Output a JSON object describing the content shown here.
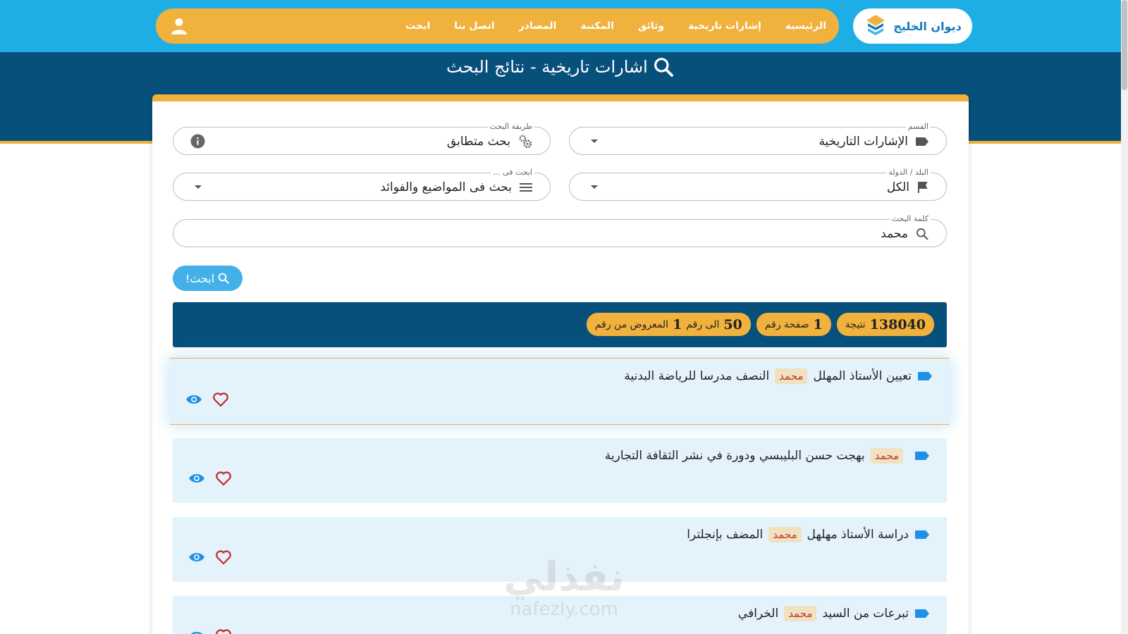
{
  "header": {
    "logo_text": "ديوان الخليج",
    "nav": [
      "الرئيسية",
      "إشارات تاريخية",
      "وثائق",
      "المكتبة",
      "المصادر",
      "اتصل بنا",
      "ابحث"
    ]
  },
  "hero": {
    "title": "اشارات تاريخية - نتائج البحث"
  },
  "filters": {
    "section": {
      "legend": "القسم",
      "value": "الإشارات التاريخية"
    },
    "method": {
      "legend": "طريقة البحث",
      "value": "بحث متطابق"
    },
    "country": {
      "legend": "البلد / الدولة",
      "value": "الكل"
    },
    "scope": {
      "legend": "ابحث فى ...",
      "value": "بحث فى المواضيع والفوائد"
    },
    "keyword": {
      "legend": "كلمة البحث",
      "value": "محمد"
    }
  },
  "search_button": "ابحث!",
  "stats": {
    "count_label": "نتيجة",
    "count": "138040",
    "page_label": "صفحة رقم",
    "page": "1",
    "shown_label": "المعروض من رقم",
    "from": "1",
    "to_label": "الى رقم",
    "to": "50"
  },
  "results": [
    {
      "before": "تعيين الأستاذ المهلل",
      "keyword": "محمد",
      "after": "النصف مدرسا للرياضة البدنية"
    },
    {
      "before": "",
      "keyword": "محمد",
      "after": "بهجت حسن البليبسي ودورة في نشر الثقافة التجارية"
    },
    {
      "before": "دراسة الأستاذ مهلهل",
      "keyword": "محمد",
      "after": "المضف بإنجلترا"
    },
    {
      "before": "تبرعات من السيد",
      "keyword": "محمد",
      "after": "الخرافي"
    }
  ],
  "watermark": {
    "line1": "نفذلي",
    "line2": "nafezly.com"
  },
  "colors": {
    "header_blue": "#1eaee6",
    "navy": "#08507c",
    "orange": "#f0b13d",
    "result_bg": "#e4f2fc"
  }
}
